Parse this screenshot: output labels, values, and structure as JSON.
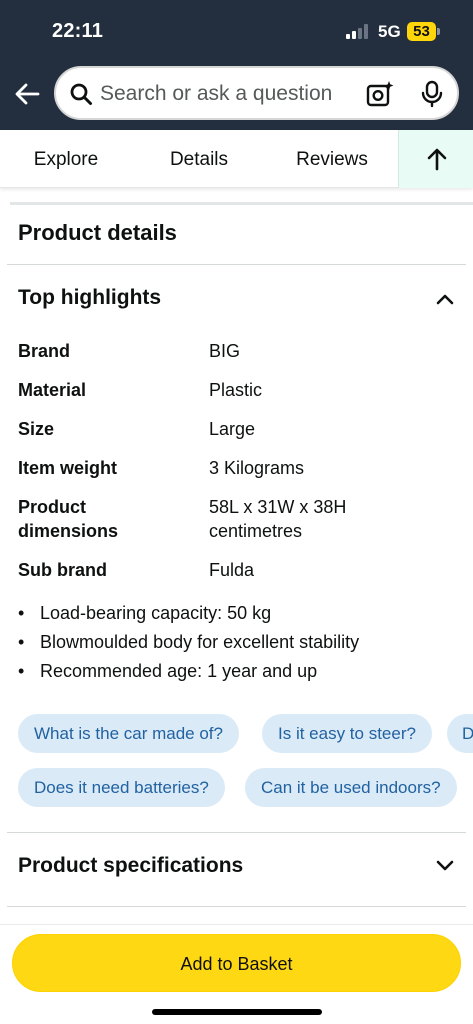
{
  "status_bar": {
    "time": "22:11",
    "network": "5G",
    "battery": "53"
  },
  "search": {
    "placeholder": "Search or ask a question"
  },
  "tabs": [
    {
      "label": "Explore"
    },
    {
      "label": "Details"
    },
    {
      "label": "Reviews"
    }
  ],
  "product_details": {
    "title": "Product details",
    "top_highlights": {
      "title": "Top highlights",
      "specs": [
        {
          "key": "Brand",
          "value": "BIG"
        },
        {
          "key": "Material",
          "value": "Plastic"
        },
        {
          "key": "Size",
          "value": "Large"
        },
        {
          "key": "Item weight",
          "value": "3 Kilograms"
        },
        {
          "key": "Product dimensions",
          "value": "58L x 31W x 38H centimetres"
        },
        {
          "key": "Sub brand",
          "value": "Fulda"
        }
      ],
      "bullets": [
        "Load-bearing capacity: 50 kg",
        "Blowmoulded body for excellent stability",
        "Recommended age: 1 year and up"
      ]
    },
    "questions": [
      "What is the car made of?",
      "Is it easy to steer?",
      "D",
      "Does it need batteries?",
      "Can it be used indoors?"
    ],
    "product_specifications": {
      "title": "Product specifications"
    }
  },
  "footer": {
    "add_to_basket": "Add to Basket"
  },
  "colors": {
    "header_bg": "#232f3e",
    "chip_bg": "#dbeaf7",
    "chip_text": "#2162a1",
    "button_yellow": "#ffd814",
    "battery_yellow": "#ffd60a",
    "up_tab_bg": "#e8fbf5"
  }
}
